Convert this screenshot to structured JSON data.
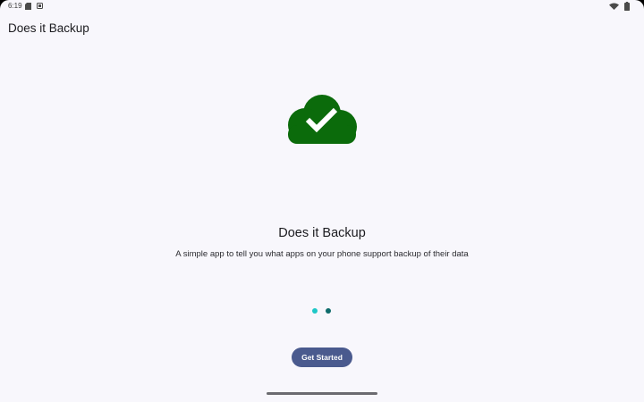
{
  "status_bar": {
    "time": "6:19",
    "icons": [
      "sd-card-icon",
      "notification-icon",
      "wifi-icon",
      "battery-icon"
    ]
  },
  "app_bar": {
    "title": "Does it Backup"
  },
  "hero": {
    "icon": "cloud-check-icon",
    "icon_color": "#0b6b0b"
  },
  "content": {
    "headline": "Does it Backup",
    "subtitle": "A simple app to tell you what apps on your phone support backup of their data"
  },
  "pager": {
    "total_pages": 2,
    "current_page": 2
  },
  "actions": {
    "get_started_label": "Get Started"
  },
  "colors": {
    "background": "#f8f7fc",
    "primary_button": "#4a5a8e",
    "dot_active": "#0e6b6b",
    "dot_inactive": "#1ec7c7"
  }
}
